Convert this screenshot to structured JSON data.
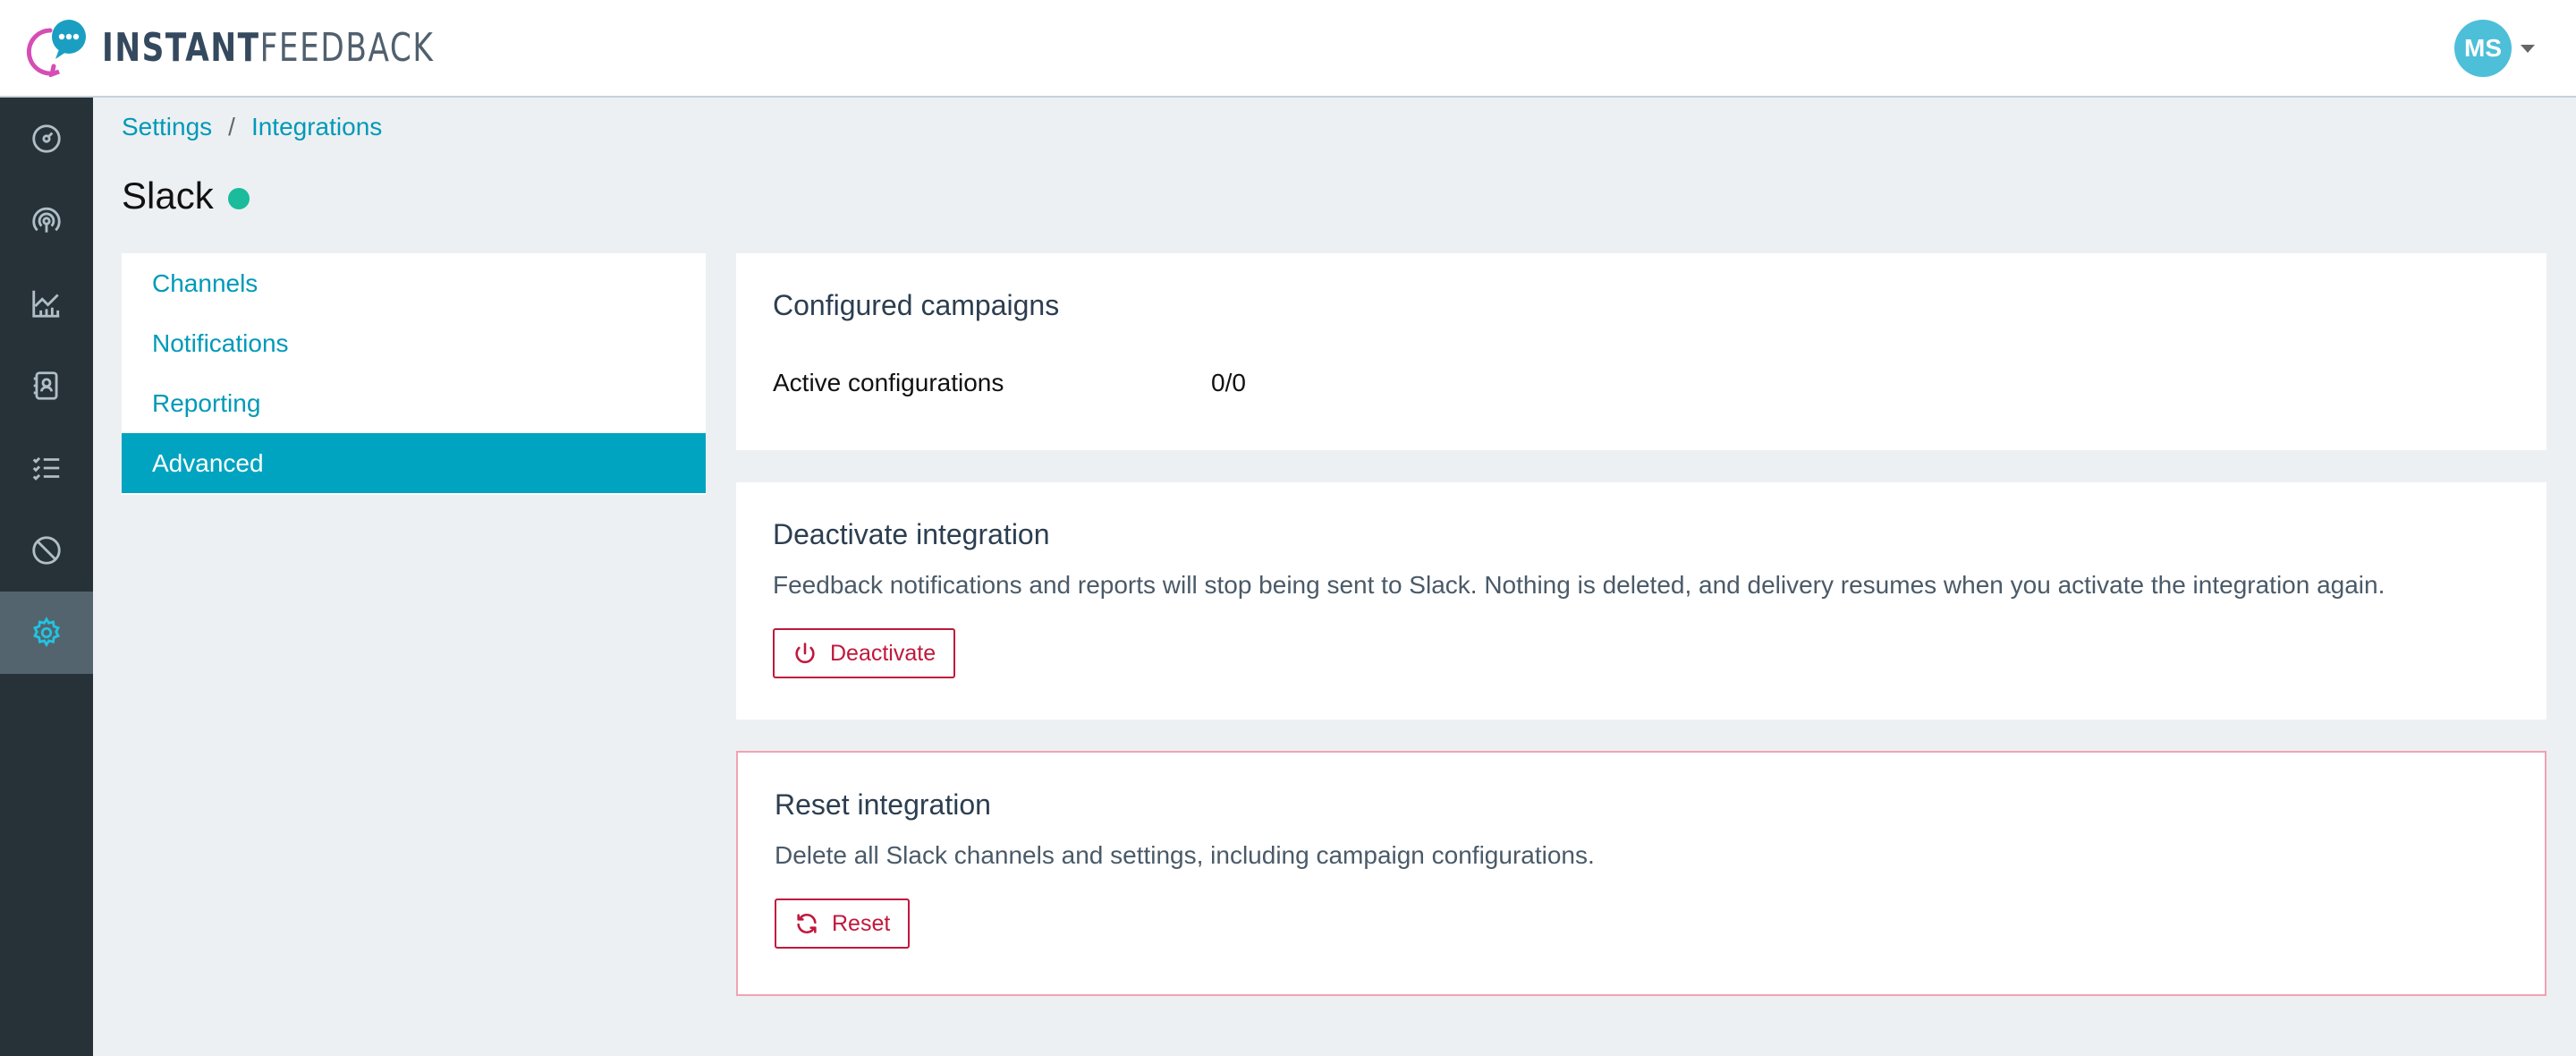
{
  "brand": {
    "name_bold": "INSTANT",
    "name_light": "FEEDBACK",
    "colors": {
      "accent": "#00a4c0",
      "link": "#0099b8",
      "danger": "#c0183c",
      "rail": "#263238",
      "status_active": "#1abc9c"
    }
  },
  "user": {
    "initials": "MS"
  },
  "rail": {
    "items": [
      {
        "icon": "dashboard-gauge-icon"
      },
      {
        "icon": "broadcast-icon"
      },
      {
        "icon": "analytics-chart-icon"
      },
      {
        "icon": "contacts-book-icon"
      },
      {
        "icon": "checklist-icon"
      },
      {
        "icon": "blocked-icon"
      },
      {
        "icon": "settings-gear-icon",
        "active": true
      }
    ]
  },
  "breadcrumb": {
    "items": [
      "Settings",
      "Integrations"
    ],
    "separator": "/"
  },
  "page": {
    "title": "Slack",
    "status": "active"
  },
  "subnav": {
    "items": [
      "Channels",
      "Notifications",
      "Reporting",
      "Advanced"
    ],
    "active": "Advanced"
  },
  "campaigns": {
    "title": "Configured campaigns",
    "label": "Active configurations",
    "value": "0/0"
  },
  "deactivate": {
    "title": "Deactivate integration",
    "description": "Feedback notifications and reports will stop being sent to Slack. Nothing is deleted, and delivery resumes when you activate the integration again.",
    "button": "Deactivate",
    "button_icon": "power-icon"
  },
  "reset": {
    "title": "Reset integration",
    "description": "Delete all Slack channels and settings, including campaign configurations.",
    "button": "Reset",
    "button_icon": "refresh-icon"
  }
}
